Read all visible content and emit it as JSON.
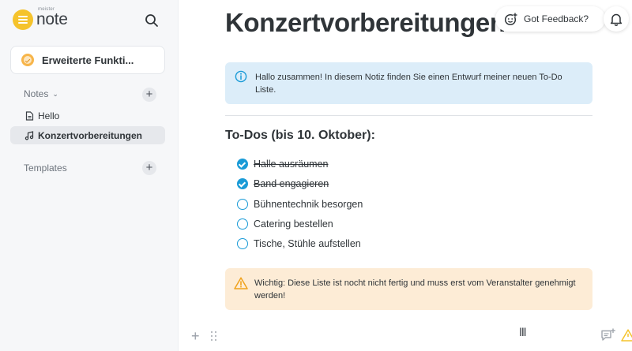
{
  "app": {
    "logo_small": "meister",
    "logo_main": "note"
  },
  "sidebar": {
    "feature_card": "Erweiterte Funkti...",
    "notes_section": "Notes",
    "templates_section": "Templates",
    "items": [
      {
        "label": "Hello",
        "icon": "document-icon",
        "active": false
      },
      {
        "label": "Konzertvorbereitungen",
        "icon": "music-note-icon",
        "active": true
      }
    ]
  },
  "header": {
    "title": "Konzertvorbereitungen",
    "feedback": "Got Feedback?"
  },
  "content": {
    "info": "Hallo zusammen! In diesem Notiz finden Sie einen Entwurf meiner neuen To-Do Liste.",
    "heading": "To-Dos (bis 10. Oktober):",
    "todos": [
      {
        "text": "Halle ausräumen",
        "done": true
      },
      {
        "text": "Band engagieren",
        "done": true
      },
      {
        "text": "Bühnentechnik besorgen",
        "done": false
      },
      {
        "text": "Catering bestellen",
        "done": false
      },
      {
        "text": "Tische, Stühle aufstellen",
        "done": false
      }
    ],
    "warning": "Wichtig: Diese Liste ist nocht nicht fertig und muss erst vom Veranstalter genehmigt werden!"
  },
  "colors": {
    "accent": "#1a9bd7",
    "logo_yellow": "#f5c32c",
    "info_bg": "#dcedf9",
    "warning_bg": "#fdecd6",
    "warning_icon": "#f0a21c"
  }
}
